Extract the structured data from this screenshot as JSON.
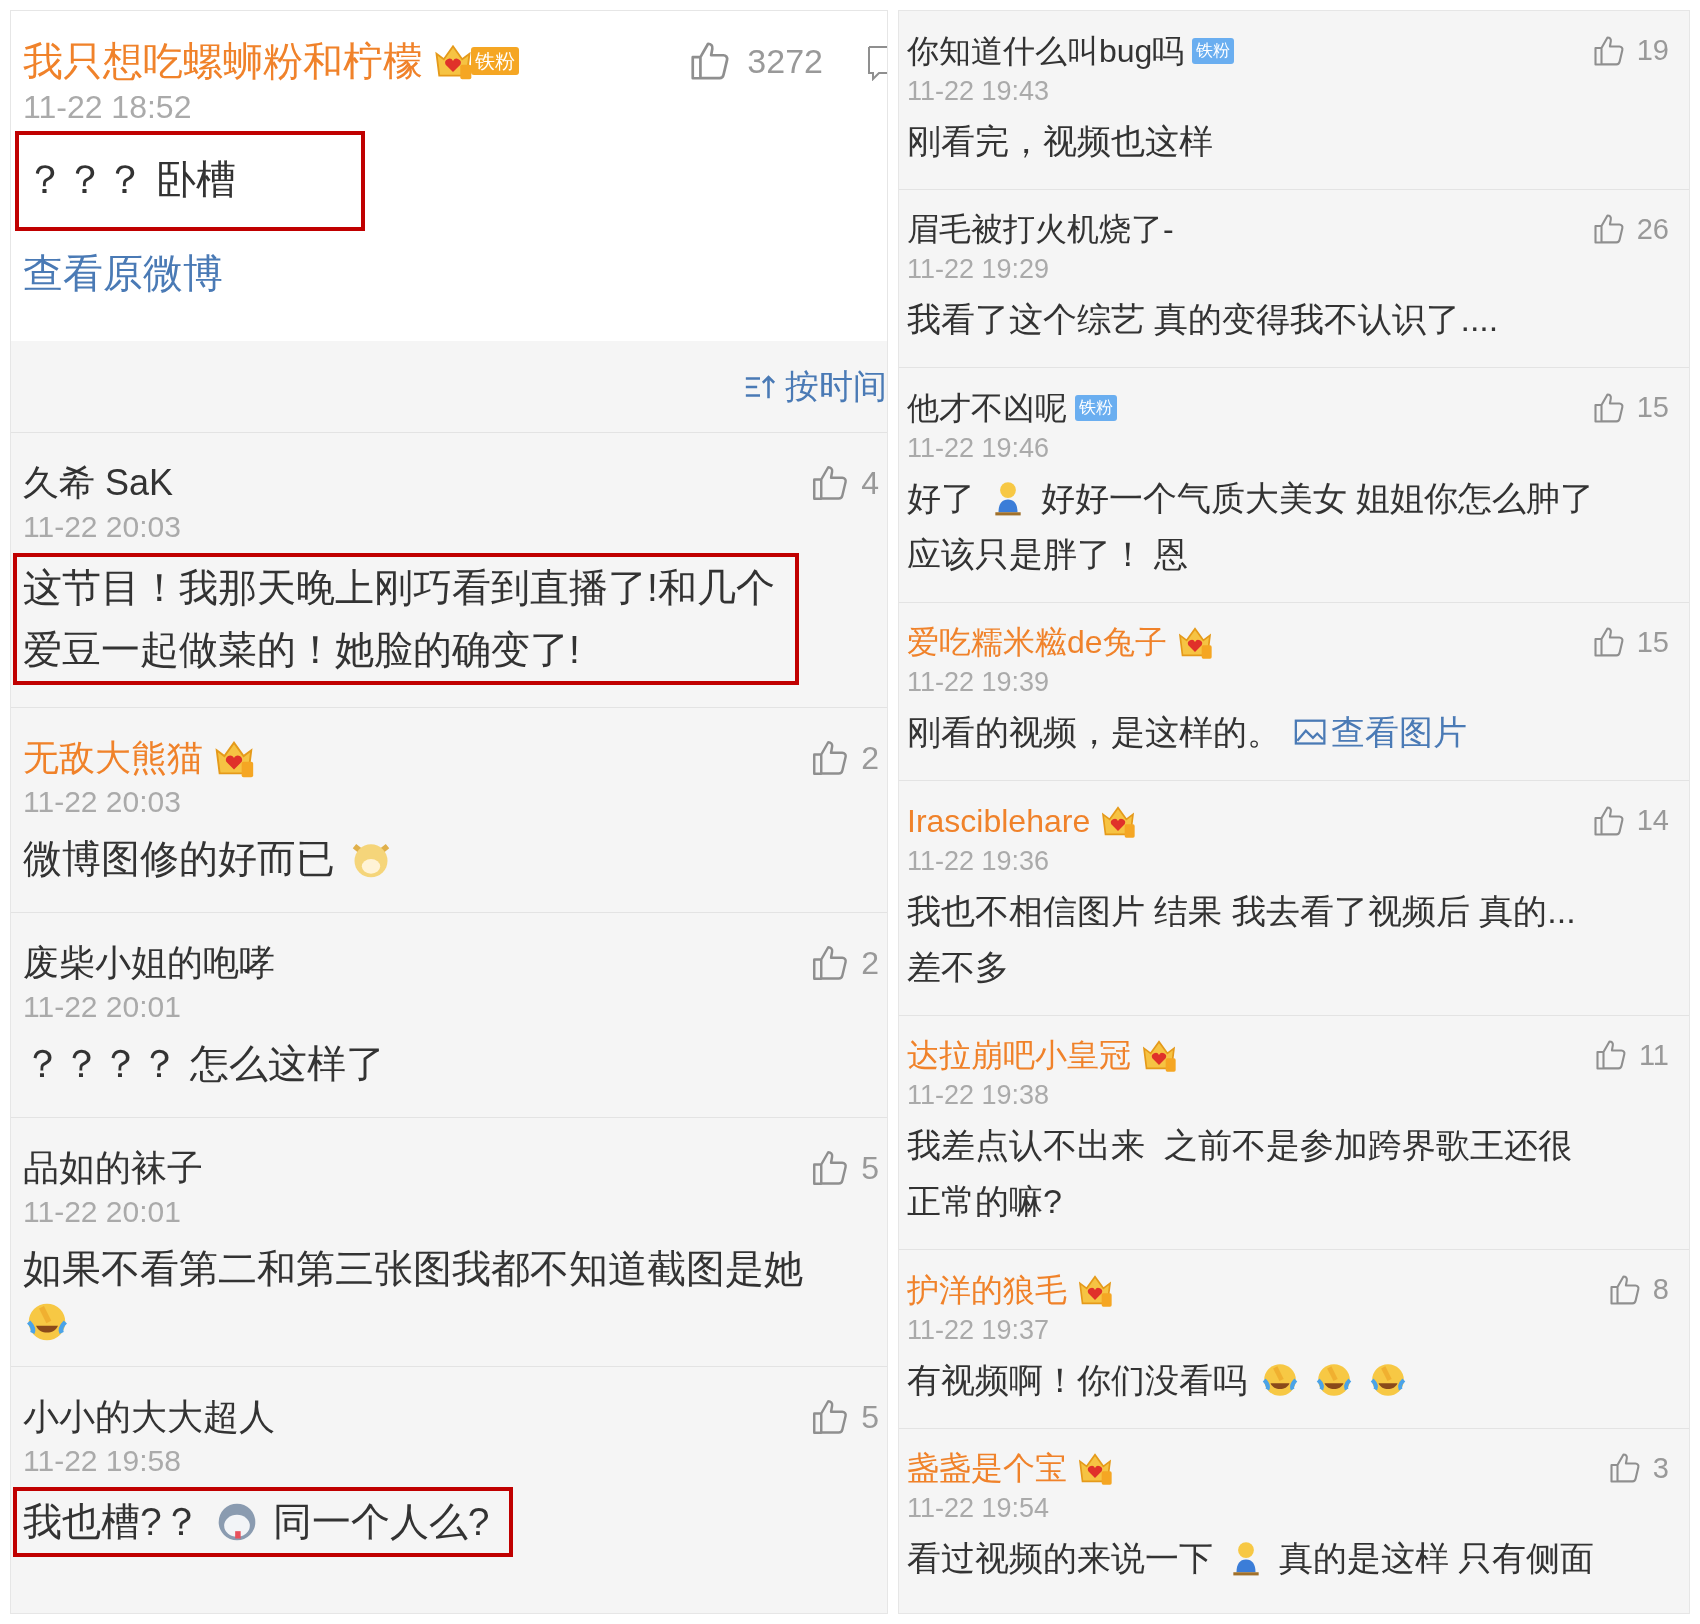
{
  "left_panel": {
    "post": {
      "author": "我只想吃螺蛳粉和柠檬",
      "member": true,
      "badge": {
        "kind": "crown_fan",
        "label": "铁粉"
      },
      "likes": "3272",
      "time": "11-22 18:52",
      "highlighted": true,
      "lines": [
        [
          {
            "kind": "text",
            "text": "？？？ 卧槽"
          }
        ]
      ],
      "link": "查看原微博"
    },
    "sort_label": "按时间",
    "comments": [
      {
        "author": "久希 SaK",
        "member": false,
        "likes": "4",
        "time": "11-22 20:03",
        "highlighted": true,
        "lines": [
          [
            {
              "kind": "text",
              "text": "这节目！我那天晚上刚巧看到直播了!和几个"
            }
          ],
          [
            {
              "kind": "text",
              "text": "爱豆一起做菜的！她脸的确变了!"
            }
          ]
        ]
      },
      {
        "author": "无敌大熊猫",
        "member": true,
        "badge": {
          "kind": "crown"
        },
        "likes": "2",
        "time": "11-22 20:03",
        "highlighted": false,
        "lines": [
          [
            {
              "kind": "text",
              "text": "微博图修的好而已"
            },
            {
              "kind": "dog"
            }
          ]
        ]
      },
      {
        "author": "废柴小姐的咆哮",
        "member": false,
        "likes": "2",
        "time": "11-22 20:01",
        "highlighted": false,
        "lines": [
          [
            {
              "kind": "text",
              "text": "？？？？ 怎么这样了"
            }
          ]
        ]
      },
      {
        "author": "品如的袜子",
        "member": false,
        "likes": "5",
        "time": "11-22 20:01",
        "highlighted": false,
        "lines": [
          [
            {
              "kind": "text",
              "text": "如果不看第二和第三张图我都不知道截图是她"
            }
          ],
          [
            {
              "kind": "laugh"
            }
          ]
        ]
      },
      {
        "author": "小小的大大超人",
        "member": false,
        "likes": "5",
        "time": "11-22 19:58",
        "highlighted": true,
        "lines": [
          [
            {
              "kind": "text",
              "text": "我也槽?？"
            },
            {
              "kind": "husky"
            },
            {
              "kind": "text",
              "text": "同一个人么?"
            }
          ]
        ]
      }
    ]
  },
  "right_panel": {
    "comments": [
      {
        "author": "你知道什么叫bug吗",
        "member": false,
        "badge": {
          "kind": "fan",
          "label": "铁粉"
        },
        "likes": "19",
        "time": "11-22 19:43",
        "highlighted": false,
        "lines": [
          [
            {
              "kind": "text",
              "text": "刚看完，视频也这样"
            }
          ]
        ]
      },
      {
        "author": "眉毛被打火机烧了-",
        "member": false,
        "likes": "26",
        "time": "11-22 19:29",
        "highlighted": false,
        "lines": [
          [
            {
              "kind": "text",
              "text": "我看了这个综艺 真的变得我不认识了...."
            }
          ]
        ]
      },
      {
        "author": "他才不凶呢",
        "member": false,
        "badge": {
          "kind": "fan",
          "label": "铁粉"
        },
        "likes": "15",
        "time": "11-22 19:46",
        "highlighted": false,
        "lines": [
          [
            {
              "kind": "text",
              "text": "好了"
            },
            {
              "kind": "figure"
            },
            {
              "kind": "text",
              "text": "好好一个气质大美女 姐姐你怎么肿了"
            }
          ],
          [
            {
              "kind": "text",
              "text": "应该只是胖了！ 恩"
            }
          ]
        ]
      },
      {
        "author": "爱吃糯米糍de兔子",
        "member": true,
        "badge": {
          "kind": "crown"
        },
        "likes": "15",
        "time": "11-22 19:39",
        "highlighted": false,
        "lines": [
          [
            {
              "kind": "text",
              "text": "刚看的视频，是这样的。"
            },
            {
              "kind": "link",
              "text": "查看图片"
            }
          ]
        ]
      },
      {
        "author": "Irasciblehare",
        "member": true,
        "badge": {
          "kind": "crown"
        },
        "likes": "14",
        "time": "11-22 19:36",
        "highlighted": false,
        "lines": [
          [
            {
              "kind": "text",
              "text": "我也不相信图片 结果 我去看了视频后 真的..."
            }
          ],
          [
            {
              "kind": "text",
              "text": "差不多"
            }
          ]
        ]
      },
      {
        "author": "达拉崩吧小皇冠",
        "member": true,
        "badge": {
          "kind": "crown"
        },
        "likes": "11",
        "time": "11-22 19:38",
        "highlighted": false,
        "lines": [
          [
            {
              "kind": "text",
              "text": "我差点认不出来  之前不是参加跨界歌王还很"
            }
          ],
          [
            {
              "kind": "text",
              "text": "正常的嘛?"
            }
          ]
        ]
      },
      {
        "author": "护洋的狼毛",
        "member": true,
        "badge": {
          "kind": "crown"
        },
        "likes": "8",
        "time": "11-22 19:37",
        "highlighted": false,
        "lines": [
          [
            {
              "kind": "text",
              "text": "有视频啊！你们没看吗"
            },
            {
              "kind": "laugh"
            },
            {
              "kind": "laugh"
            },
            {
              "kind": "laugh"
            }
          ]
        ]
      },
      {
        "author": "盏盏是个宝",
        "member": true,
        "badge": {
          "kind": "crown"
        },
        "likes": "3",
        "time": "11-22 19:54",
        "highlighted": false,
        "lines": [
          [
            {
              "kind": "text",
              "text": "看过视频的来说一下"
            },
            {
              "kind": "figure"
            },
            {
              "kind": "text",
              "text": "真的是这样 只有侧面"
            }
          ]
        ]
      }
    ]
  }
}
